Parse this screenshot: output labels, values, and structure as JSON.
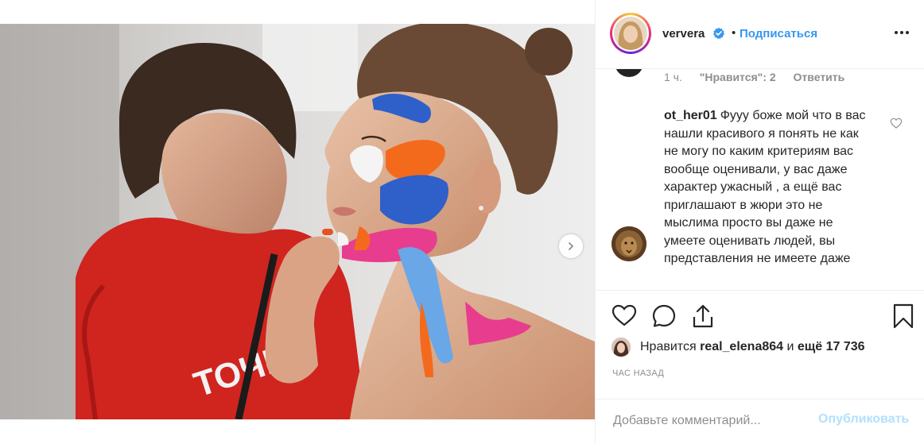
{
  "post": {
    "image_alt": "",
    "carousel_dots": 2,
    "active_dot": 0
  },
  "header": {
    "username": "ververa",
    "separator": "•",
    "follow_label": "Подписаться",
    "verified_icon": "verified-badge-icon",
    "more_icon": "more-options-icon"
  },
  "previous_comment_meta": {
    "time": "1 ч.",
    "likes": "\"Нравится\": 2",
    "reply": "Ответить"
  },
  "comment": {
    "username": "ot_her01",
    "text": "Фууу боже мой что в вас нашли красивого я понять не как не могу по каким критериям вас вообще оценивали, у вас даже характер ужасный , а ещё вас приглашают в жюри это не мыслима просто вы даже не умеете оценивать людей, вы представления не имеете даже"
  },
  "actions": {
    "like_icon": "heart-icon",
    "comment_icon": "comment-bubble-icon",
    "share_icon": "share-icon",
    "save_icon": "bookmark-icon"
  },
  "likes": {
    "prefix": "Нравится",
    "user": "real_elena864",
    "conjunction": "и",
    "others": "ещё 17 736"
  },
  "timestamp": "ЧАС НАЗАД",
  "add_comment": {
    "placeholder": "Добавьте комментарий...",
    "post_label": "Опубликовать"
  },
  "colors": {
    "accent": "#3897f0",
    "post_disabled": "#b2dffc",
    "muted": "#8e8e8e",
    "text": "#262626",
    "border": "#efefef"
  }
}
